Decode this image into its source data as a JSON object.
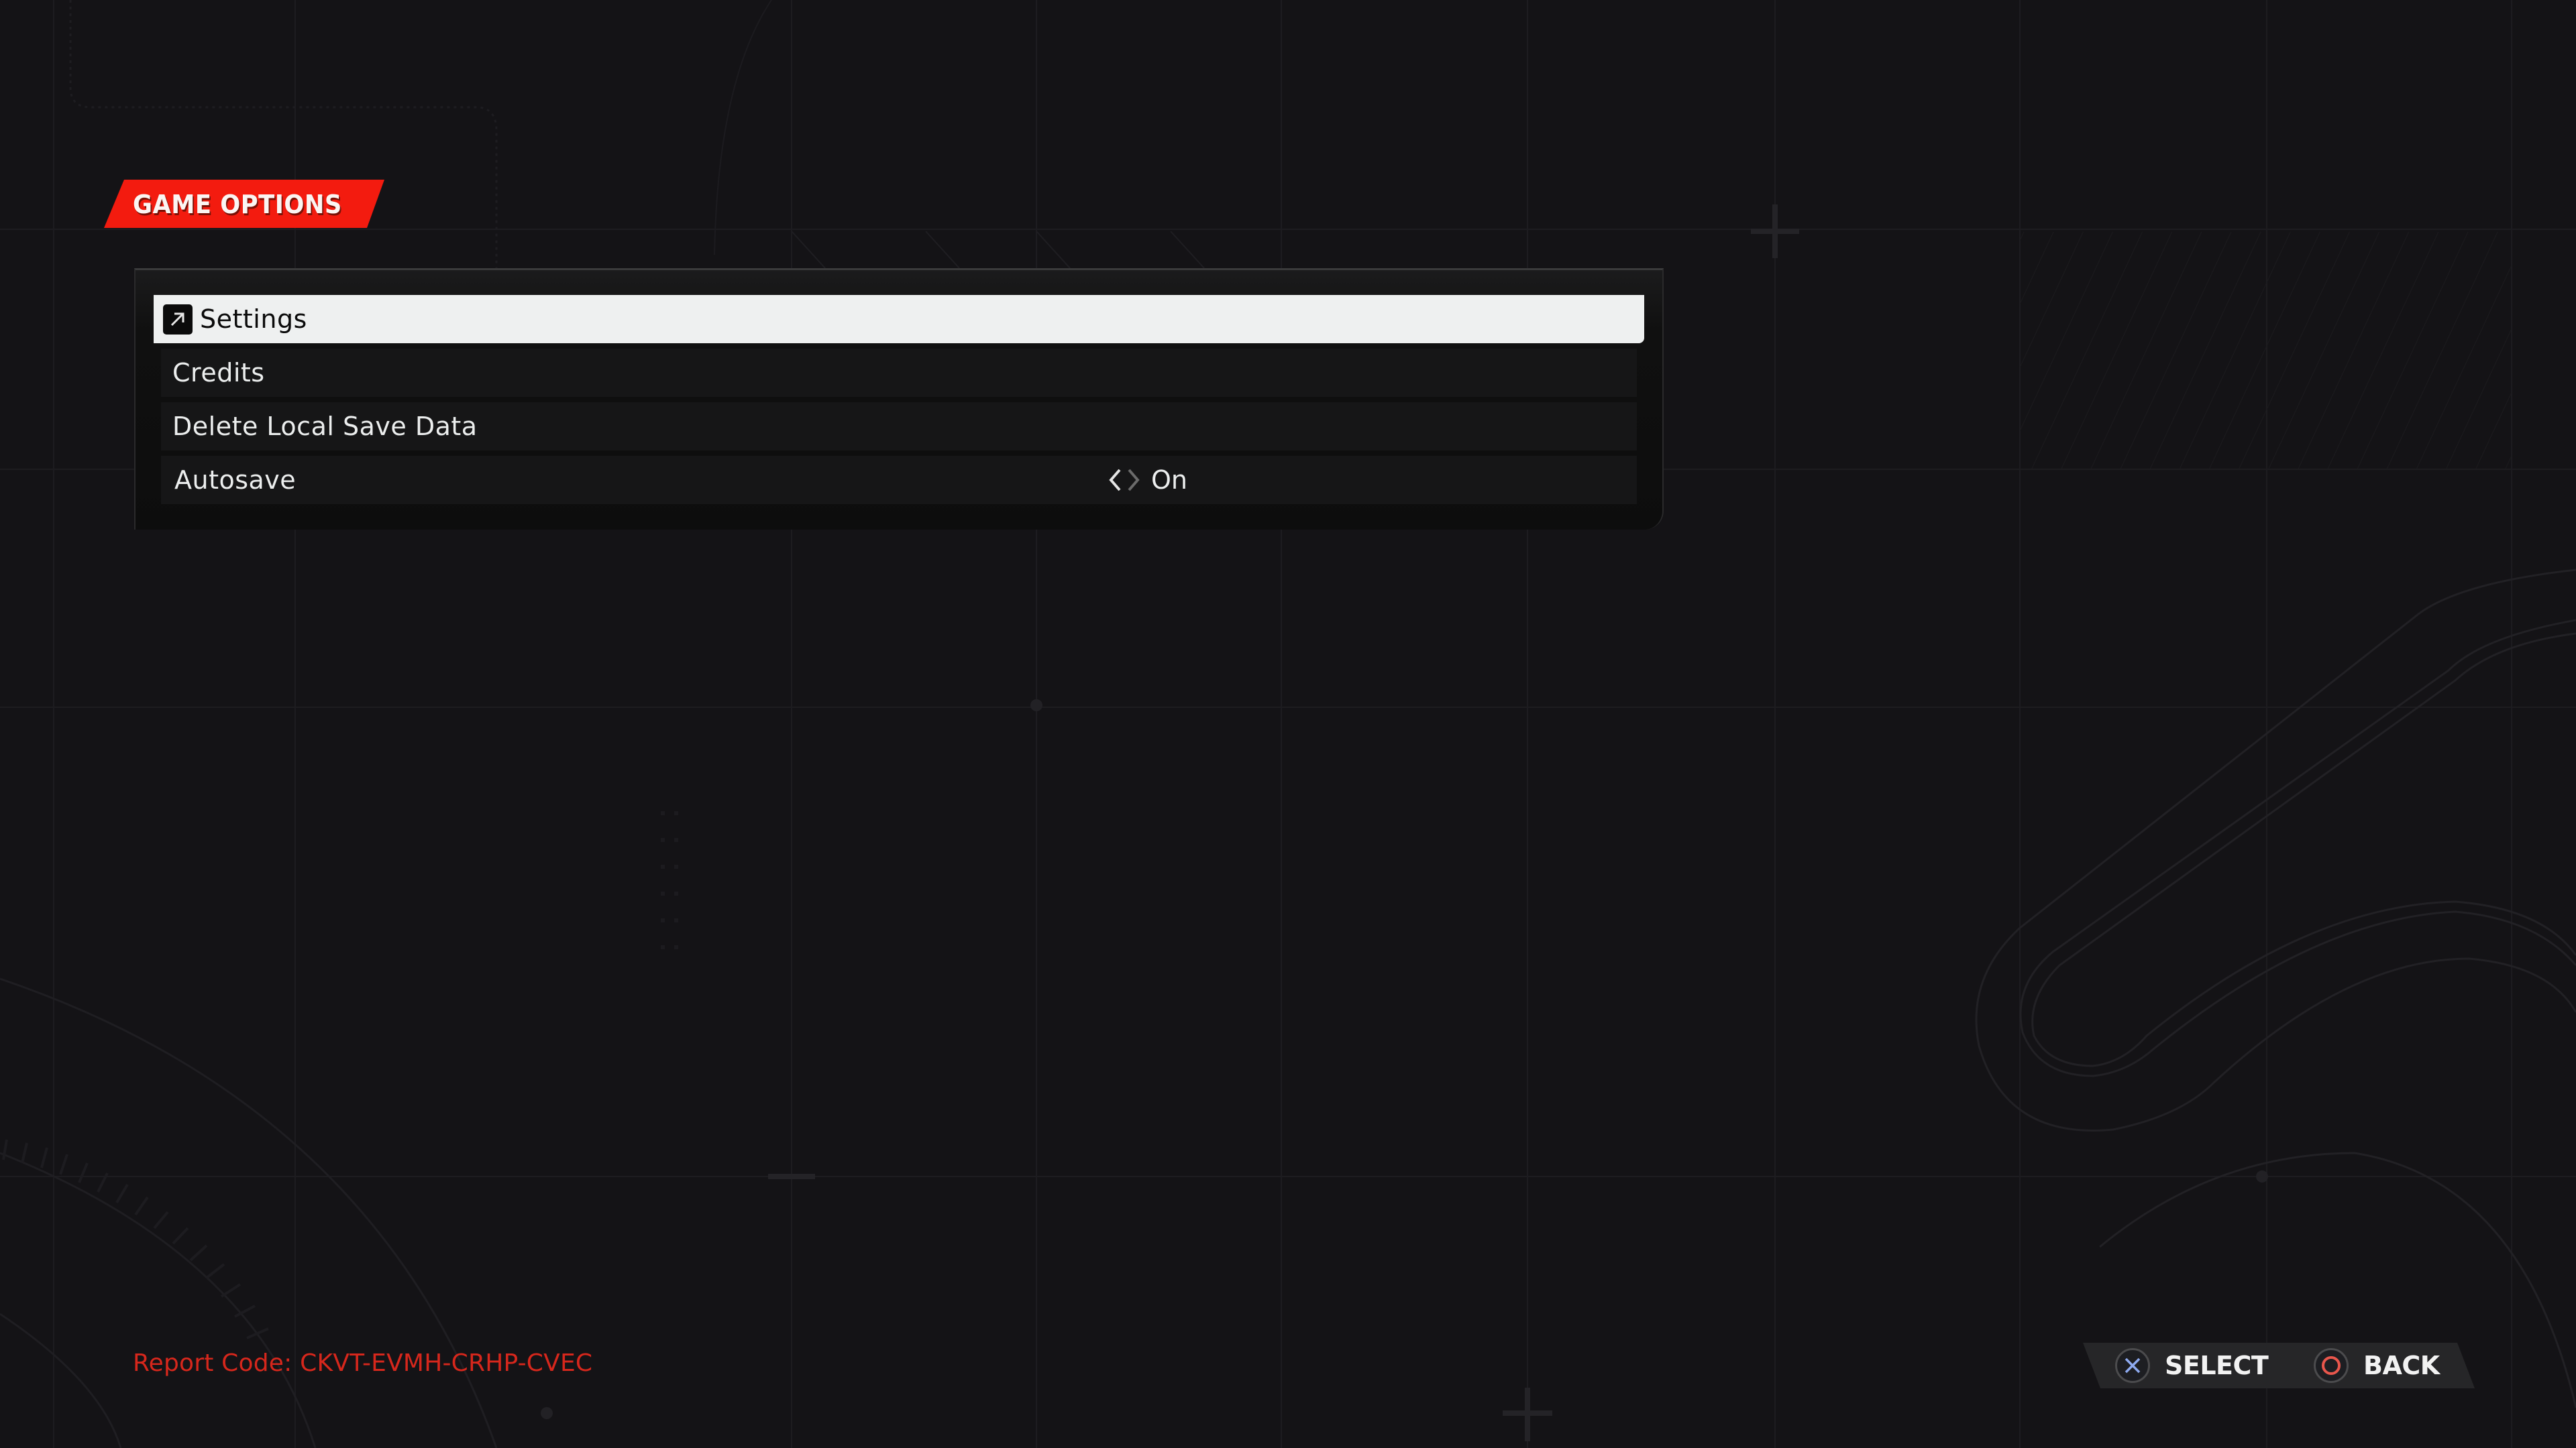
{
  "header": {
    "title": "GAME OPTIONS"
  },
  "menu": {
    "items": [
      {
        "label": "Settings",
        "selected": true,
        "icon": "external-link-icon"
      },
      {
        "label": "Credits",
        "selected": false
      },
      {
        "label": "Delete Local Save Data",
        "selected": false
      },
      {
        "label": "Autosave",
        "selected": false,
        "value": "On",
        "control": "toggle"
      }
    ]
  },
  "report": {
    "text": "Report Code: CKVT-EVMH-CRHP-CVEC"
  },
  "footer": {
    "select": {
      "label": "SELECT",
      "icon": "cross-button-icon"
    },
    "back": {
      "label": "BACK",
      "icon": "circle-button-icon"
    }
  },
  "colors": {
    "accent_red": "#f31b0f",
    "report_red": "#d6271c",
    "cross_blue": "#8eaaf0",
    "circle_red": "#e8564c",
    "selected_row": "#eef0f0",
    "background": "#141316"
  }
}
